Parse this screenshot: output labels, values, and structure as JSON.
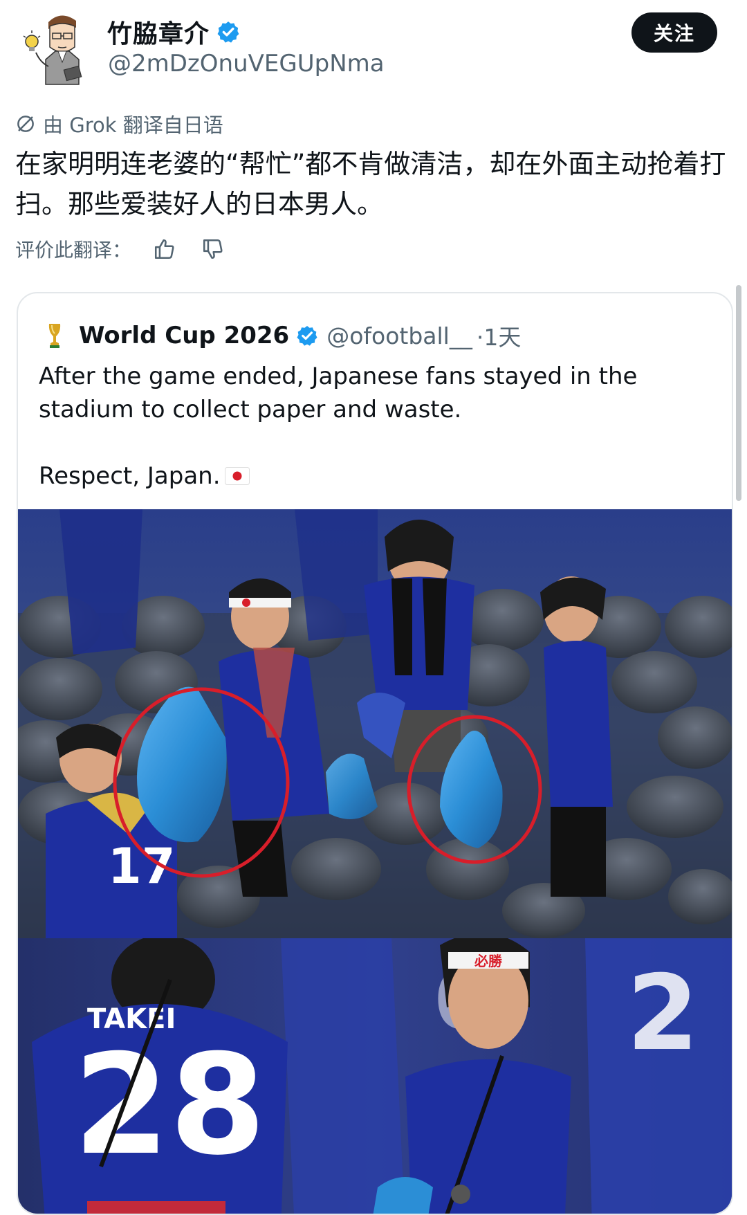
{
  "header": {
    "display_name": "竹脇章介",
    "handle": "@2mDzOnuVEGUpNma",
    "follow_label": "关注",
    "verified_icon": "verified-badge-icon"
  },
  "translation": {
    "note": "由 Grok 翻译自日语",
    "text": "在家明明连老婆的“帮忙”都不肯做清洁，却在外面主动抢着打扫。那些爱装好人的日本男人。",
    "rate_label": "评价此翻译："
  },
  "quote": {
    "name": "World Cup 2026",
    "handle": "@ofootball__",
    "time": "·1天",
    "text_line1": "After the game ended, Japanese fans stayed in the stadium to collect paper and waste.",
    "text_line2": "Respect, Japan."
  },
  "colors": {
    "accent_blue": "#1d9bf0",
    "text_primary": "#0f1419",
    "text_secondary": "#536471",
    "button_dark": "#0f1419",
    "jersey_blue": "#1e2fa0",
    "bag_blue": "#2b8ed6",
    "circle_red": "#d81e2a"
  }
}
